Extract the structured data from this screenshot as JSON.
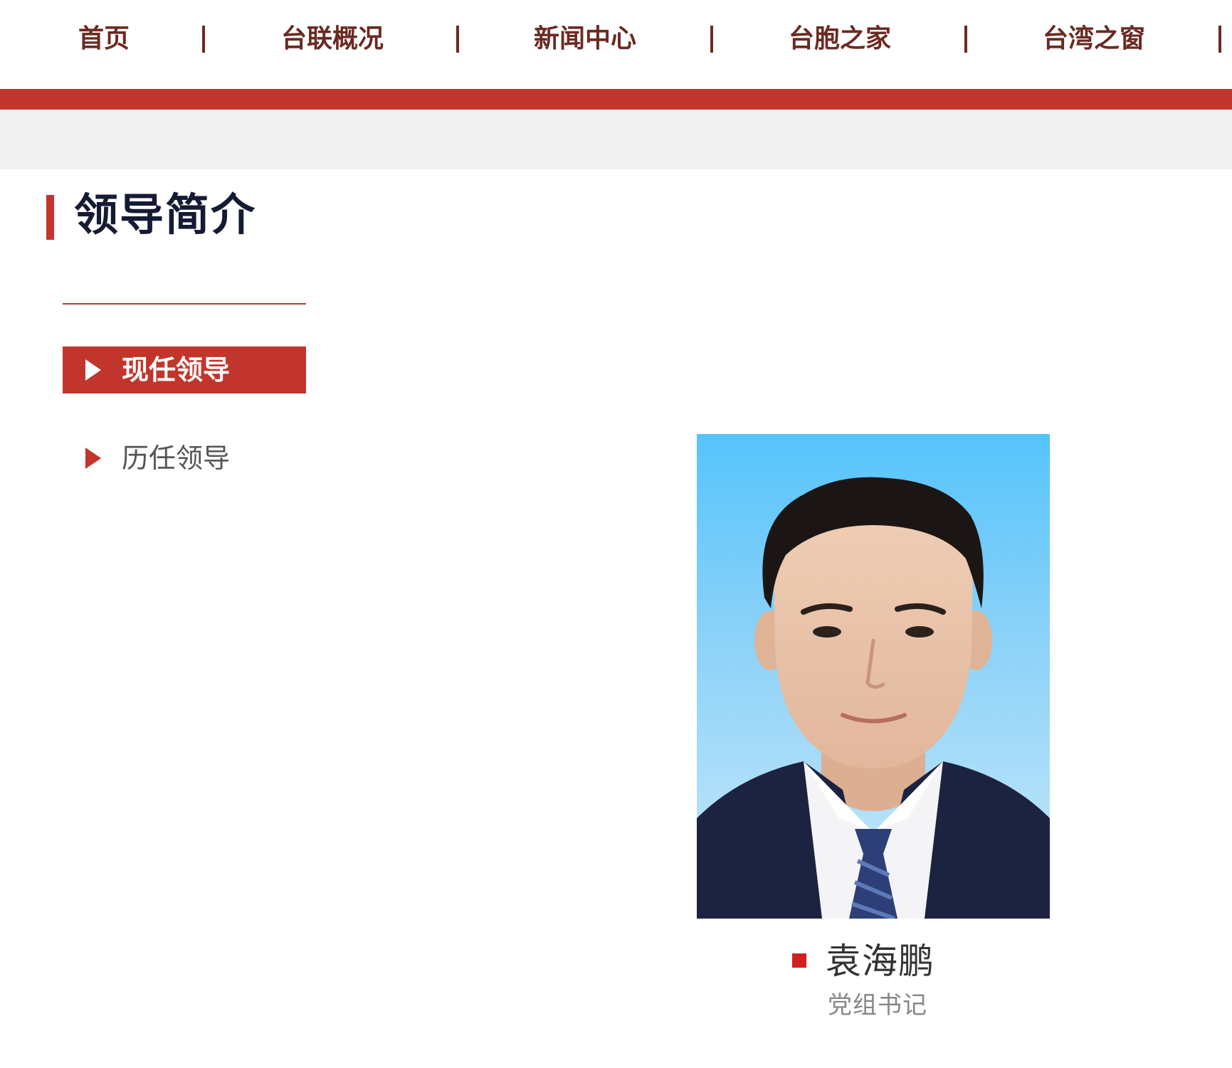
{
  "nav": {
    "items": [
      {
        "label": "首页"
      },
      {
        "label": "台联概况"
      },
      {
        "label": "新闻中心"
      },
      {
        "label": "台胞之家"
      },
      {
        "label": "台湾之窗"
      }
    ]
  },
  "section": {
    "title": "领导简介"
  },
  "menu": {
    "items": [
      {
        "label": "现任领导",
        "active": true
      },
      {
        "label": "历任领导",
        "active": false
      }
    ]
  },
  "leader": {
    "name": "袁海鹏",
    "position": "党组书记"
  },
  "colors": {
    "accent_red": "#c1352c",
    "nav_text": "#6b2a22",
    "title_text": "#151b33",
    "grey_band": "#f1f1f1",
    "photo_sky": "#55c4fb"
  },
  "icons": {
    "menu_arrow": "play-triangle-icon",
    "name_bullet": "square-bullet-icon"
  }
}
